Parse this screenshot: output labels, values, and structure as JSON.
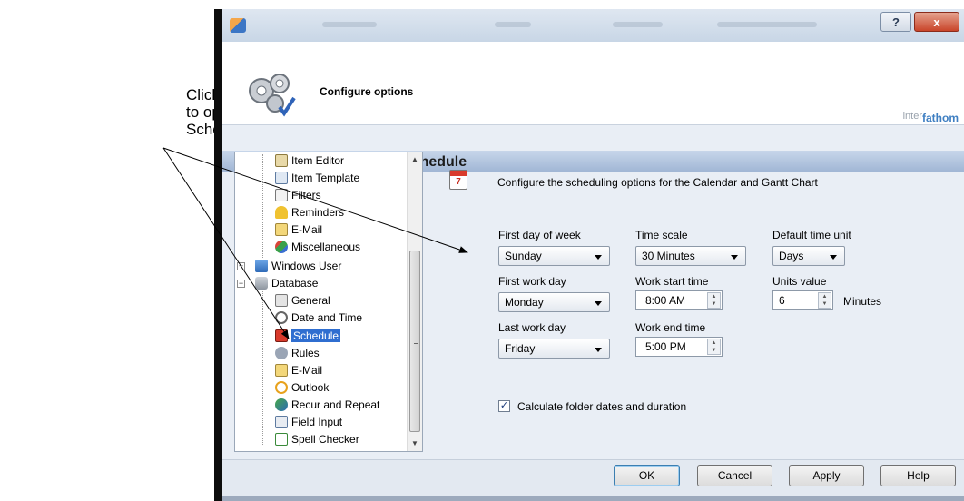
{
  "callout": {
    "lines": [
      "Click Schedule",
      "to open the",
      "Schedule fields."
    ]
  },
  "titlebar": {
    "help_label": "?",
    "close_label": "x"
  },
  "header": {
    "title": "Configure options",
    "brand_prefix": "inter",
    "brand_suffix": "fathom"
  },
  "section": {
    "title": "Schedule"
  },
  "tree": {
    "items": [
      {
        "label": "Item Editor",
        "icon": "item-editor-icon"
      },
      {
        "label": "Item Template",
        "icon": "item-template-icon"
      },
      {
        "label": "Filters",
        "icon": "filters-icon"
      },
      {
        "label": "Reminders",
        "icon": "bell-icon"
      },
      {
        "label": "E-Mail",
        "icon": "email-icon"
      },
      {
        "label": "Miscellaneous",
        "icon": "shapes-icon"
      },
      {
        "label": "Windows User",
        "icon": "windows-user-icon"
      },
      {
        "label": "Database",
        "icon": "database-icon"
      },
      {
        "label": "General",
        "icon": "general-icon"
      },
      {
        "label": "Date and Time",
        "icon": "clock-icon"
      },
      {
        "label": "Schedule",
        "icon": "calendar-icon"
      },
      {
        "label": "Rules",
        "icon": "rules-icon"
      },
      {
        "label": "E-Mail",
        "icon": "email-icon"
      },
      {
        "label": "Outlook",
        "icon": "outlook-icon"
      },
      {
        "label": "Recur and Repeat",
        "icon": "recur-icon"
      },
      {
        "label": "Field Input",
        "icon": "field-input-icon"
      },
      {
        "label": "Spell Checker",
        "icon": "spell-check-icon"
      }
    ],
    "selected": "Schedule",
    "expand_symbol": "+",
    "collapse_symbol": "−"
  },
  "schedule": {
    "description": "Configure the scheduling options for the Calendar and Gantt Chart",
    "icon_number": "7",
    "first_day_label": "First day of week",
    "first_day_value": "Sunday",
    "time_scale_label": "Time scale",
    "time_scale_value": "30 Minutes",
    "default_unit_label": "Default time unit",
    "default_unit_value": "Days",
    "first_work_day_label": "First work day",
    "first_work_day_value": "Monday",
    "work_start_label": "Work start time",
    "work_start_value": "8:00 AM",
    "units_value_label": "Units value",
    "units_value": "6",
    "units_suffix": "Minutes",
    "last_work_day_label": "Last work day",
    "last_work_day_value": "Friday",
    "work_end_label": "Work end time",
    "work_end_value": "5:00 PM",
    "calc_label": "Calculate folder dates and duration",
    "calc_checked": true
  },
  "buttons": {
    "ok": "OK",
    "cancel": "Cancel",
    "apply": "Apply",
    "help": "Help"
  },
  "colors": {
    "selection": "#2f6ed0",
    "section_bar": "#9fb5d4",
    "close_button": "#c9452a"
  }
}
